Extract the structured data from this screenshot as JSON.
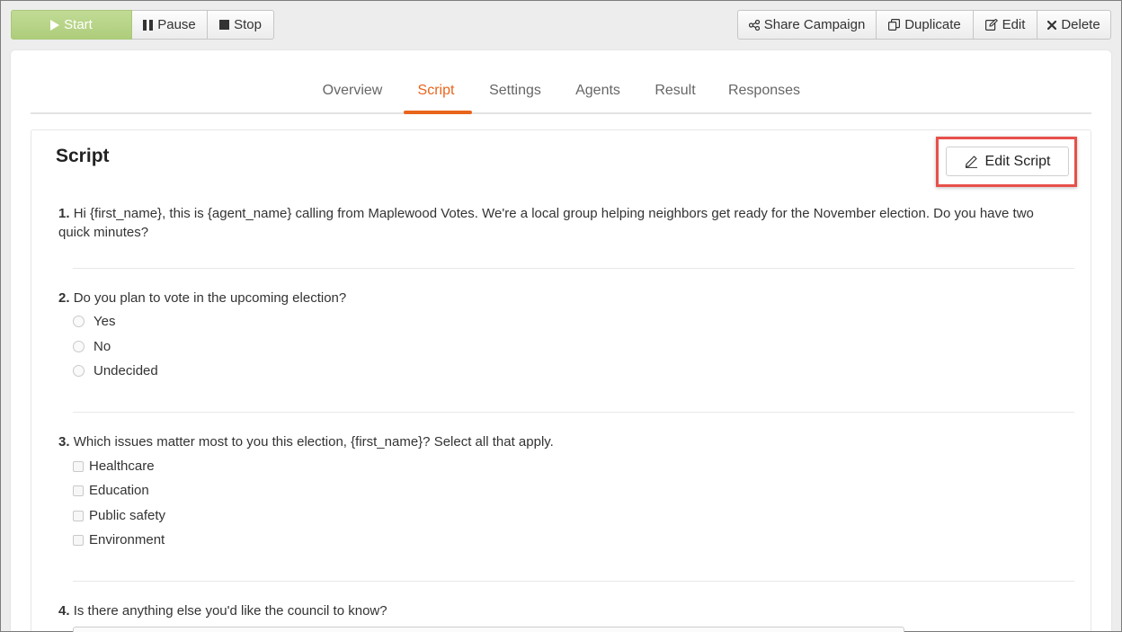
{
  "toolbar": {
    "start_label": "Start",
    "pause_label": "Pause",
    "stop_label": "Stop",
    "share_label": "Share Campaign",
    "duplicate_label": "Duplicate",
    "edit_label": "Edit",
    "delete_label": "Delete"
  },
  "tabs": {
    "items": [
      {
        "label": "Overview"
      },
      {
        "label": "Script"
      },
      {
        "label": "Settings"
      },
      {
        "label": "Agents"
      },
      {
        "label": "Result"
      },
      {
        "label": "Responses"
      }
    ],
    "active": "Script"
  },
  "script": {
    "title": "Script",
    "edit_button_label": "Edit Script",
    "questions": [
      {
        "number": "1.",
        "text": "Hi {first_name}, this is {agent_name} calling from Maplewood Votes. We're a local group helping neighbors get ready for the November election. Do you have two quick minutes?"
      },
      {
        "number": "2.",
        "text": "Do you plan to vote in the upcoming election?",
        "options": [
          "Yes",
          "No",
          "Undecided"
        ]
      },
      {
        "number": "3.",
        "text": "Which issues matter most to you this election, {first_name}? Select all that apply.",
        "options": [
          "Healthcare",
          "Education",
          "Public safety",
          "Environment"
        ]
      },
      {
        "number": "4.",
        "text": "Is there anything else you'd like the council to know?"
      }
    ]
  },
  "colors": {
    "accent": "#e8651c",
    "start_button": "#aecd7b",
    "highlight": "#e8504a"
  }
}
